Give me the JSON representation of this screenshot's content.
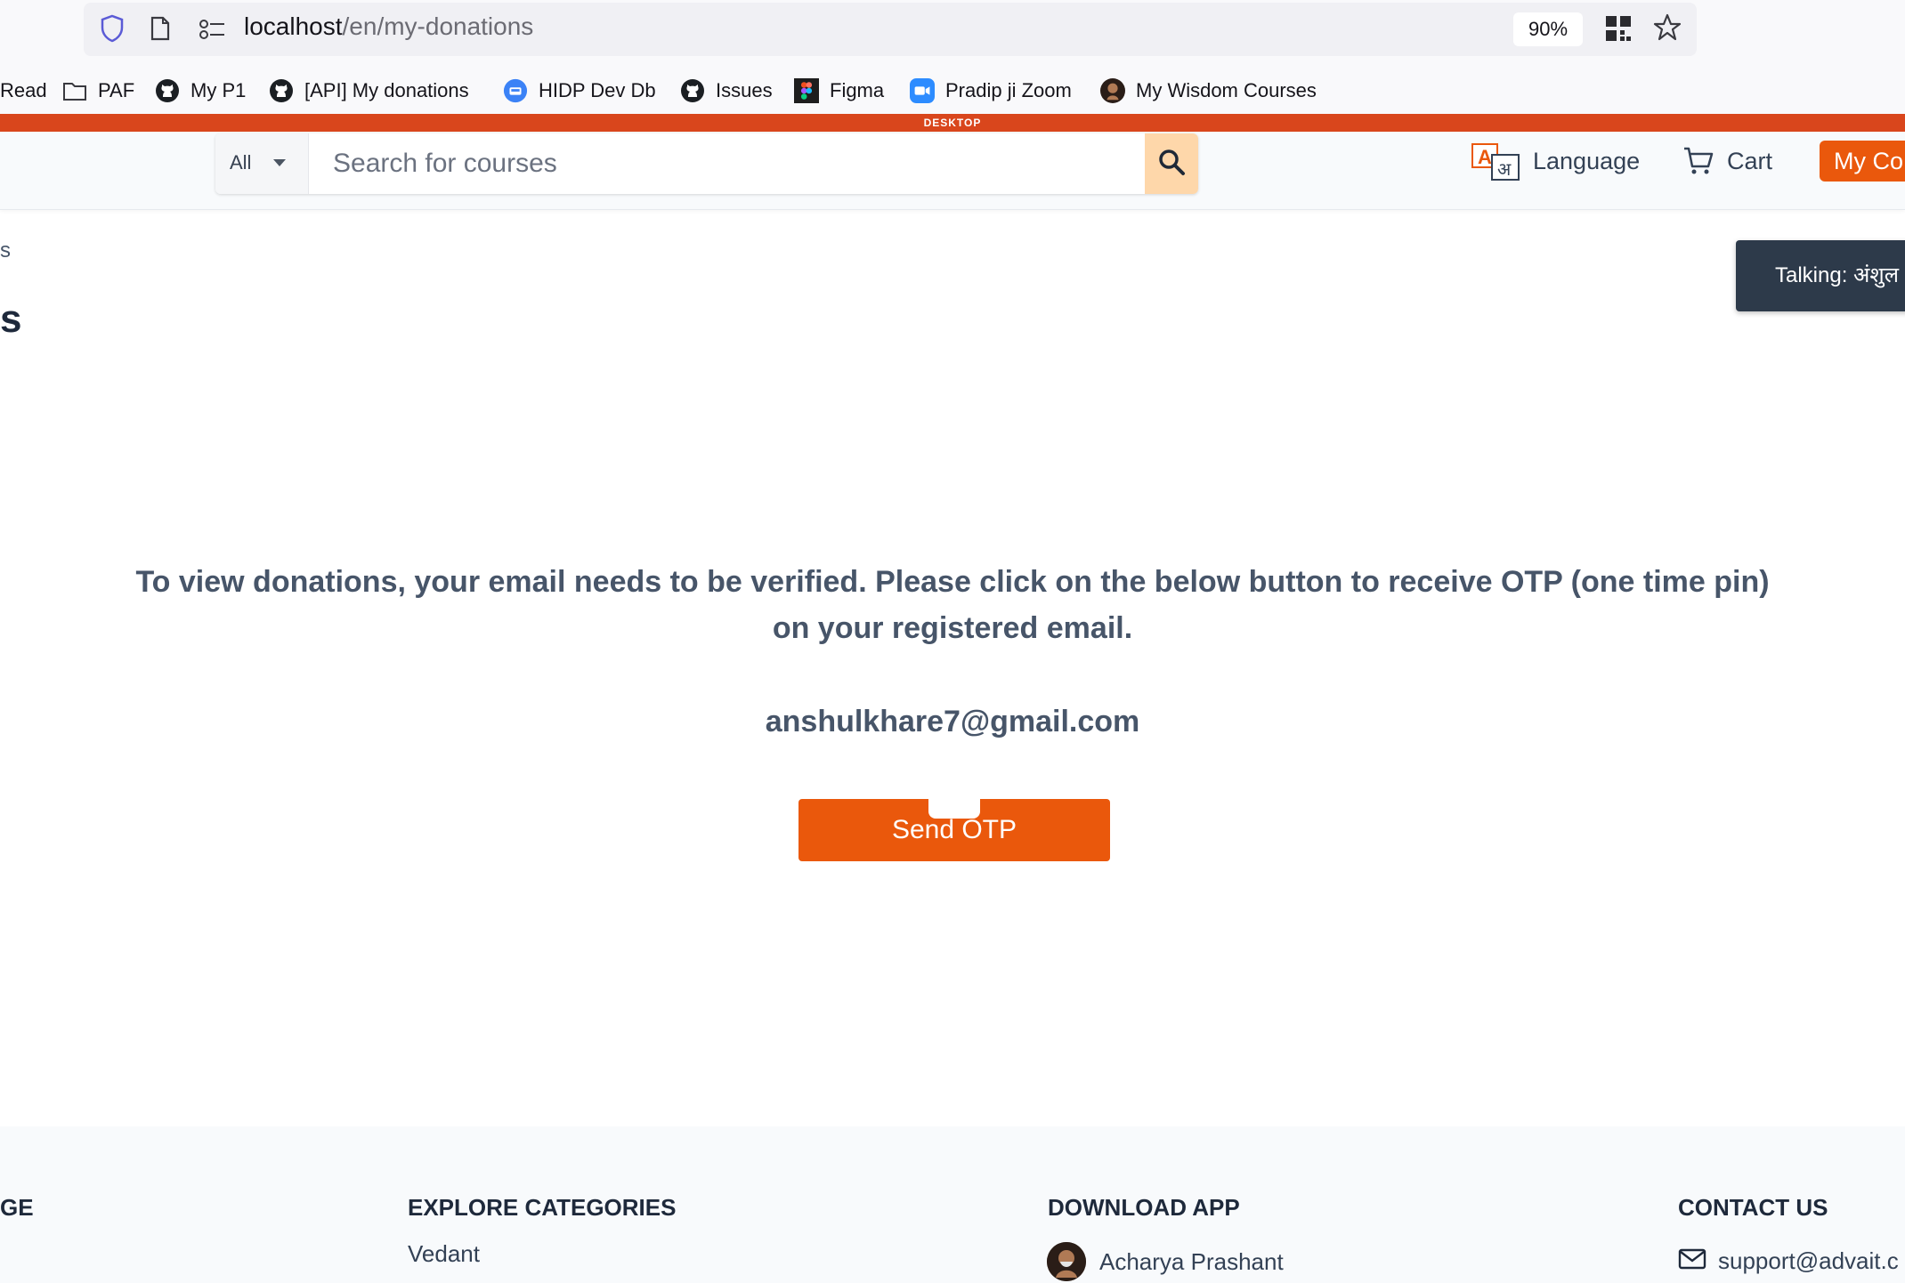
{
  "browser": {
    "url_host": "localhost",
    "url_path": "/en/my-donations",
    "zoom": "90%",
    "bookmarks": [
      {
        "label": "Read",
        "icon": "none"
      },
      {
        "label": "PAF",
        "icon": "folder-icon"
      },
      {
        "label": "My P1",
        "icon": "github-icon"
      },
      {
        "label": "[API] My donations",
        "icon": "github-icon"
      },
      {
        "label": "HIDP Dev Db",
        "icon": "database-icon"
      },
      {
        "label": "Issues",
        "icon": "github-icon"
      },
      {
        "label": "Figma",
        "icon": "figma-icon"
      },
      {
        "label": "Pradip ji Zoom",
        "icon": "zoom-icon"
      },
      {
        "label": "My Wisdom Courses",
        "icon": "avatar-icon"
      }
    ]
  },
  "strip": {
    "label": "DESKTOP",
    "color": "#d9461c"
  },
  "header": {
    "category": "All",
    "search_placeholder": "Search for courses",
    "language_label": "Language",
    "cart_label": "Cart",
    "my_courses_label": "My Co"
  },
  "page": {
    "breadcrumb_fragment": "s",
    "title_fragment": "s",
    "toast": "Talking: अंशुल",
    "message": "To view donations, your email needs to be verified. Please click on the below button to receive OTP (one time pin) on your registered email.",
    "email": "anshulkhare7@gmail.com",
    "send_otp_label": "Send OTP",
    "accent_color": "#ea580c"
  },
  "footer": {
    "col1_heading_fragment": "GE",
    "col2_heading": "EXPLORE CATEGORIES",
    "col2_link": "Vedant",
    "col3_heading": "DOWNLOAD APP",
    "col3_link": "Acharya Prashant",
    "col4_heading": "CONTACT US",
    "col4_link": "support@advait.c"
  }
}
